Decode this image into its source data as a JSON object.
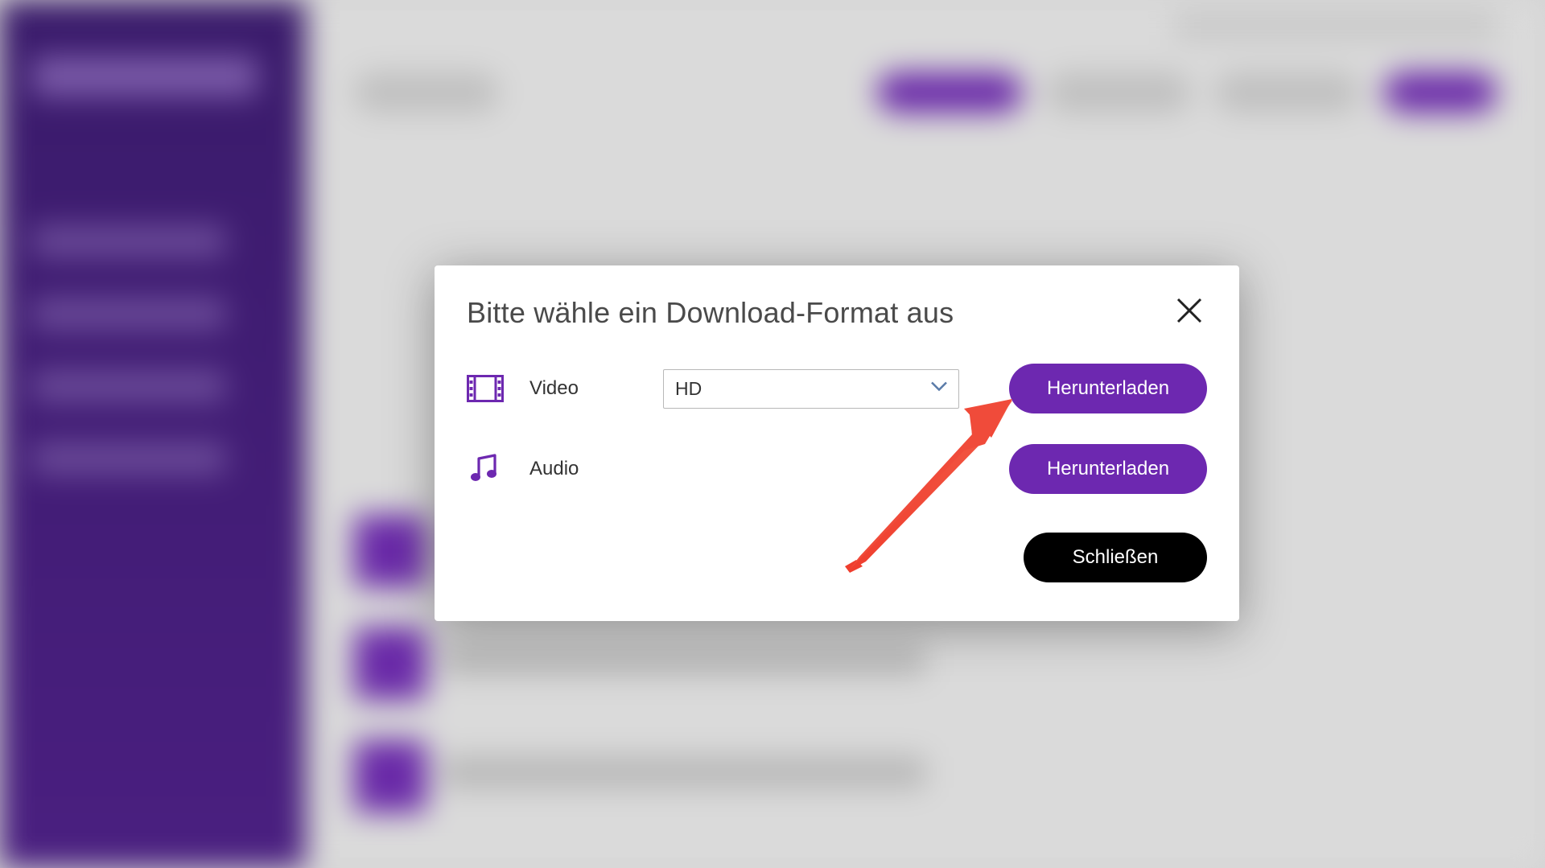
{
  "modal": {
    "title": "Bitte wähle ein Download-Format aus",
    "video": {
      "label": "Video",
      "selected": "HD",
      "download_label": "Herunterladen"
    },
    "audio": {
      "label": "Audio",
      "download_label": "Herunterladen"
    },
    "close_label": "Schließen"
  },
  "colors": {
    "brand": "#6d28b0",
    "close_bg": "#000000",
    "arrow": "#f04b3a"
  }
}
